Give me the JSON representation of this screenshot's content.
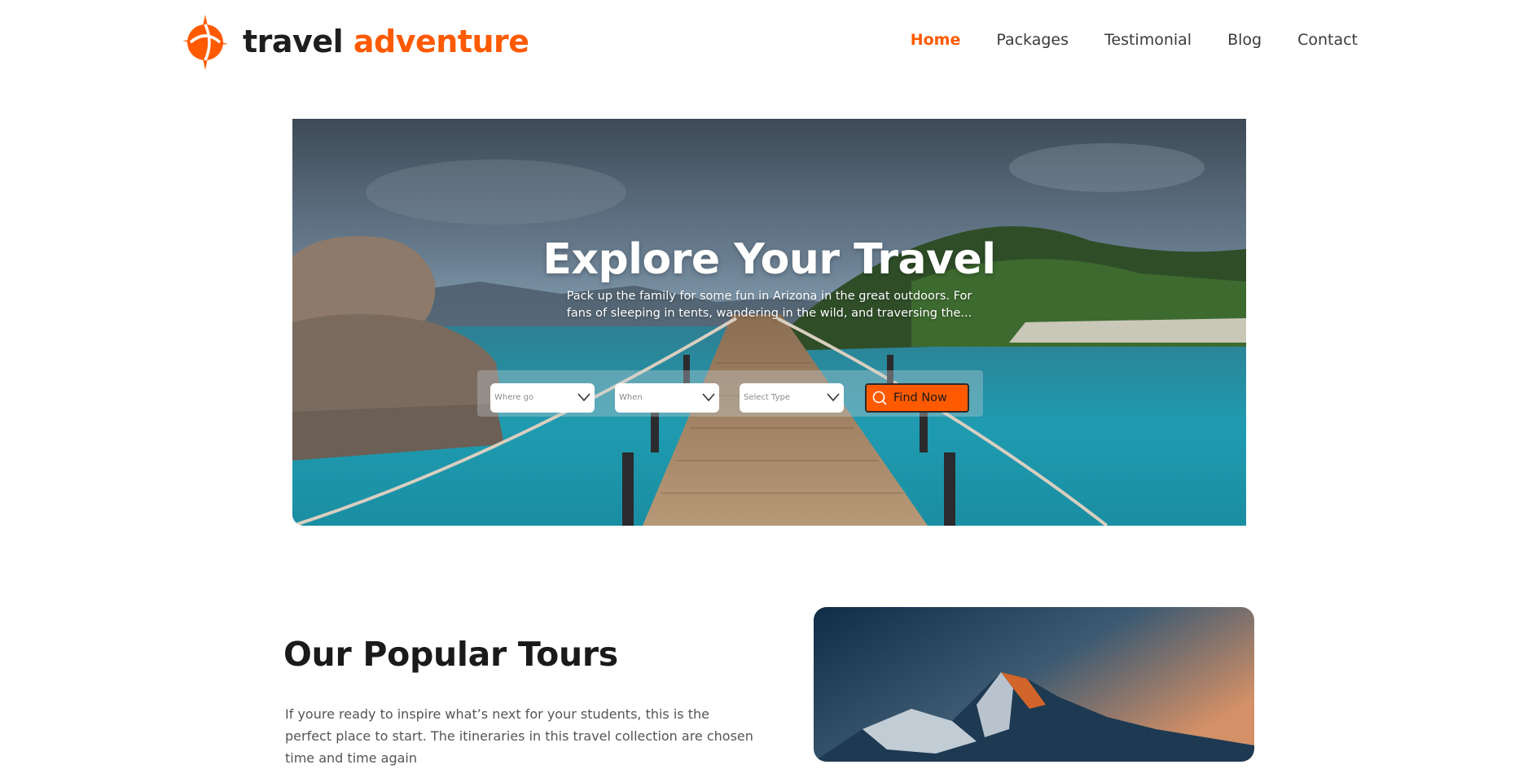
{
  "brand": {
    "part1": "travel",
    "part2": "adventure",
    "accent_color": "#ff5a00"
  },
  "nav": {
    "items": [
      {
        "label": "Home",
        "active": true
      },
      {
        "label": "Packages",
        "active": false
      },
      {
        "label": "Testimonial",
        "active": false
      },
      {
        "label": "Blog",
        "active": false
      },
      {
        "label": "Contact",
        "active": false
      }
    ]
  },
  "hero": {
    "title": "Explore Your Travel",
    "subtitle": "Pack up the family for some fun in Arizona in the great outdoors. For fans of sleeping in tents, wandering in the wild, and traversing the...",
    "search": {
      "where_placeholder": "Where go",
      "when_placeholder": "When",
      "type_placeholder": "Select Type",
      "button_label": "Find Now",
      "button_icon": "search-icon"
    }
  },
  "tours": {
    "title": "Our Popular Tours",
    "description": "If youre ready to inspire what’s next for your students, this is the perfect place to start. The itineraries in this travel collection are chosen time and time again"
  }
}
